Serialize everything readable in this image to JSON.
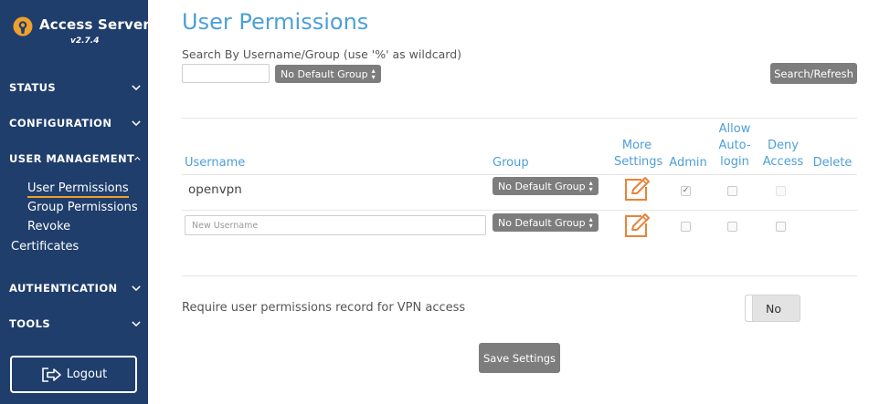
{
  "sidebar": {
    "brand_title": "Access Server",
    "brand_version": "v2.7.4",
    "sections": {
      "status": "STATUS",
      "configuration": "CONFIGURATION",
      "user_management": "USER MANAGEMENT",
      "authentication": "AUTHENTICATION",
      "tools": "TOOLS"
    },
    "user_management_items": [
      "User Permissions",
      "Group Permissions",
      "Revoke"
    ],
    "certificates": "Certificates",
    "logout_label": "Logout",
    "colors": {
      "background": "#1f3e6c",
      "active_underline": "#f0a02c"
    }
  },
  "main": {
    "title": "User Permissions",
    "search_label": "Search By Username/Group (use '%' as wildcard)",
    "search_value": "",
    "group_filter_value": "No Default Group",
    "search_button": "Search/Refresh",
    "columns": {
      "username": "Username",
      "group": "Group",
      "more_settings_1": "More",
      "more_settings_2": "Settings",
      "admin": "Admin",
      "allow_autologin_1": "Allow",
      "allow_autologin_2": "Auto-",
      "allow_autologin_3": "login",
      "deny_access_1": "Deny",
      "deny_access_2": "Access",
      "delete": "Delete"
    },
    "rows": [
      {
        "username": "openvpn",
        "group": "No Default Group",
        "admin": true,
        "allow_autologin": false,
        "deny_access": false
      }
    ],
    "new_row": {
      "placeholder": "New Username",
      "group": "No Default Group",
      "admin": false,
      "allow_autologin": false,
      "deny_access": false
    },
    "require_label": "Require user permissions record for VPN access",
    "require_toggle_value": "No",
    "save_button": "Save Settings",
    "colors": {
      "accent": "#4d9fd6",
      "edit_icon": "#e8843a",
      "button_grey": "#7d7d7d"
    }
  }
}
